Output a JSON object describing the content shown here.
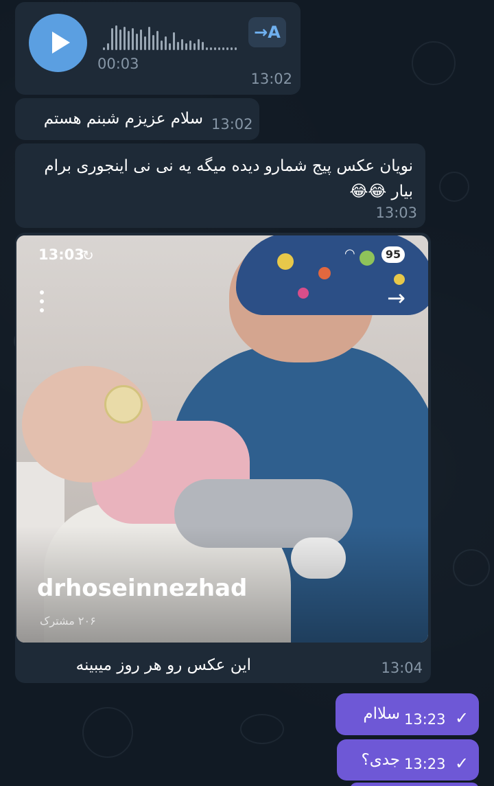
{
  "voice_message": {
    "duration": "00:03",
    "time": "13:02",
    "transcribe_label": "→A"
  },
  "messages_in": [
    {
      "text": "سلام عزیزم شبنم هستم",
      "time": "13:02"
    },
    {
      "text": "نویان عکس پیج شمارو دیده میگه یه نی نی اینجوری برام بیار 😂😂",
      "time": "13:03"
    }
  ],
  "photo_message": {
    "status_time": "13:03",
    "battery": "95",
    "username": "drhoseinnezhad",
    "subscribers": "۲۰۶ مشترک",
    "caption": "این عکس رو هر روز میبینه",
    "time": "13:04"
  },
  "messages_out": [
    {
      "text": "سلاام",
      "time": "13:23"
    },
    {
      "text": "جدی؟",
      "time": "13:23"
    }
  ],
  "colors": {
    "background": "#111a24",
    "incoming_bubble": "#1e2a37",
    "outgoing_bubble": "#6e58d6",
    "play_button": "#5b9fe1",
    "timestamp": "#8696a6"
  },
  "icons": [
    "play-icon",
    "transcribe-icon",
    "sync-icon",
    "wifi-icon",
    "menu-dots-icon",
    "forward-arrow-icon",
    "check-icon"
  ]
}
